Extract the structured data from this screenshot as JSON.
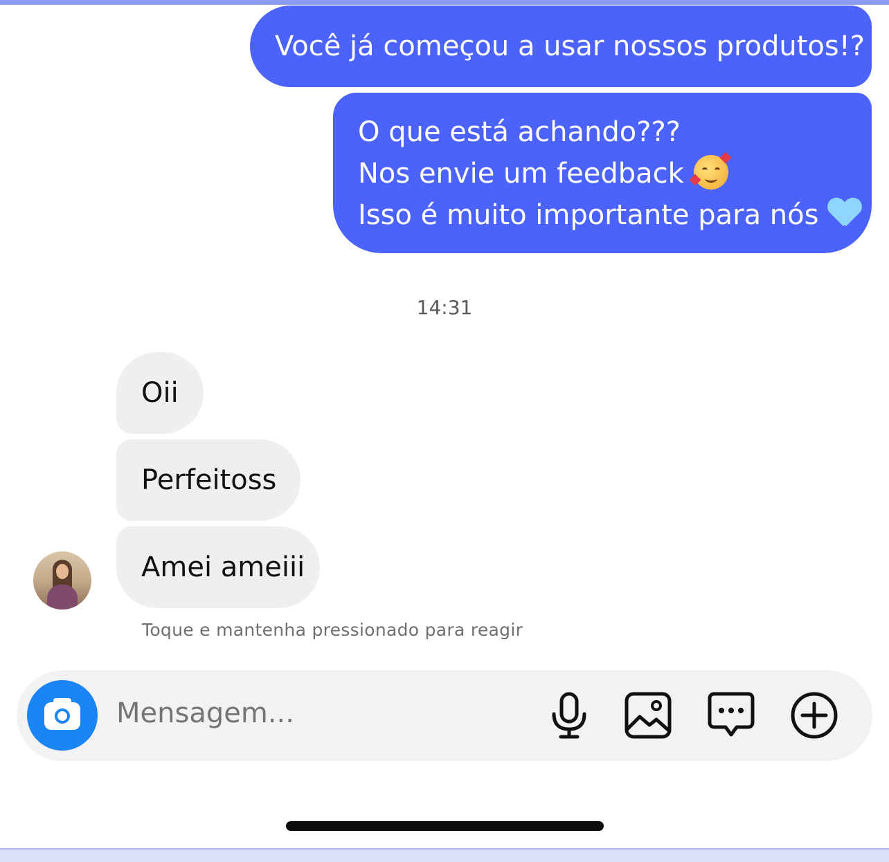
{
  "messages_sent": [
    {
      "text": "Você já começou a usar nossos produtos!?"
    },
    {
      "lines": [
        "O que está achando???",
        "Nos envie um feedback",
        "Isso é muito importante para nós"
      ]
    }
  ],
  "sent_emojis": [
    "smiling-face-with-hearts",
    "light-blue-heart"
  ],
  "timestamp": "14:31",
  "messages_received": [
    "Oii",
    "Perfeitoss",
    "Amei ameiii"
  ],
  "react_hint": "Toque e mantenha pressionado para reagir",
  "composer": {
    "placeholder": "Mensagem...",
    "icons": [
      "camera-icon",
      "microphone-icon",
      "gallery-icon",
      "chat-options-icon",
      "add-icon"
    ]
  },
  "colors": {
    "sent_bubble": "#4b63fb",
    "received_bubble": "#efefef",
    "camera_button": "#1b85f5"
  }
}
